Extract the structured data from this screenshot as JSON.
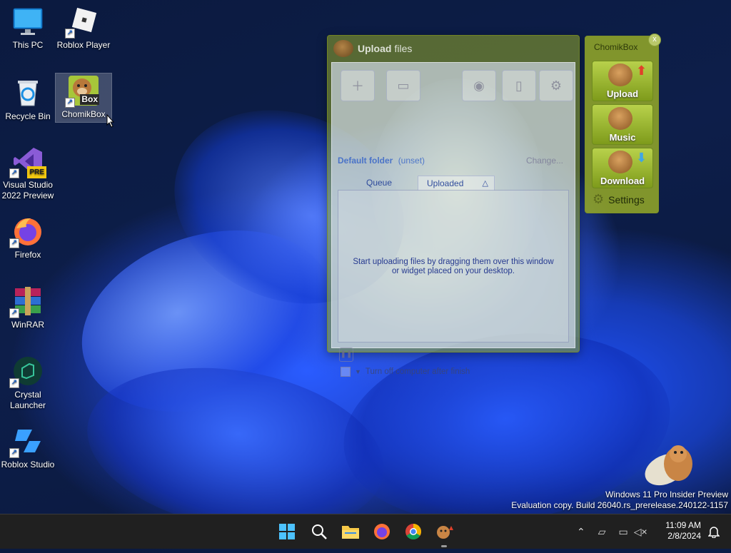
{
  "desktop": {
    "icons": [
      {
        "label": "This PC"
      },
      {
        "label": "Roblox Player"
      },
      {
        "label": "Recycle Bin"
      },
      {
        "label": "ChomikBox"
      },
      {
        "label": "Visual Studio 2022 Preview",
        "badge": "PRE"
      },
      {
        "label": "Firefox"
      },
      {
        "label": "WinRAR"
      },
      {
        "label": "Crystal Launcher"
      },
      {
        "label": "Roblox Studio"
      }
    ],
    "chomikbox_icon_text": "Box"
  },
  "upload_window": {
    "title_bold": "Upload",
    "title_rest": "files",
    "default_folder_label": "Default folder",
    "default_folder_value": "(unset)",
    "change_link": "Change...",
    "tabs": [
      {
        "label": "Queue"
      },
      {
        "label": "Uploaded"
      }
    ],
    "empty_hint": "Start uploading files by dragging them over this window or widget placed on your desktop.",
    "turn_off_label": "Turn off computer after finish"
  },
  "widget": {
    "title": "ChomikBox",
    "buttons": [
      {
        "label": "Upload"
      },
      {
        "label": "Music"
      },
      {
        "label": "Download"
      }
    ],
    "settings_label": "Settings"
  },
  "watermark": {
    "line1": "Windows 11 Pro Insider Preview",
    "line2": "Evaluation copy. Build 26040.rs_prerelease.240122-1157"
  },
  "taskbar": {
    "time": "11:09 AM",
    "date": "2/8/2024"
  },
  "colors": {
    "chomik_green": "#96aa28",
    "taskbar_bg": "#202020"
  }
}
